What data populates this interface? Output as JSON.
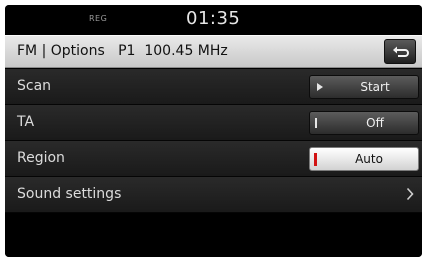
{
  "status": {
    "indicator": "REG",
    "time": "01:35"
  },
  "titlebar": {
    "title": "FM | Options   P1  100.45 MHz",
    "back_icon": "back-arrow-icon"
  },
  "options": [
    {
      "label": "Scan",
      "button": "Start",
      "button_style": "dark",
      "marker": "play"
    },
    {
      "label": "TA",
      "button": "Off",
      "button_style": "dark",
      "marker": "bar"
    },
    {
      "label": "Region",
      "button": "Auto",
      "button_style": "light",
      "marker": "red-bar"
    },
    {
      "label": "Sound settings",
      "icon": "chevron-right-icon"
    }
  ],
  "colors": {
    "accent_red": "#d21212"
  }
}
